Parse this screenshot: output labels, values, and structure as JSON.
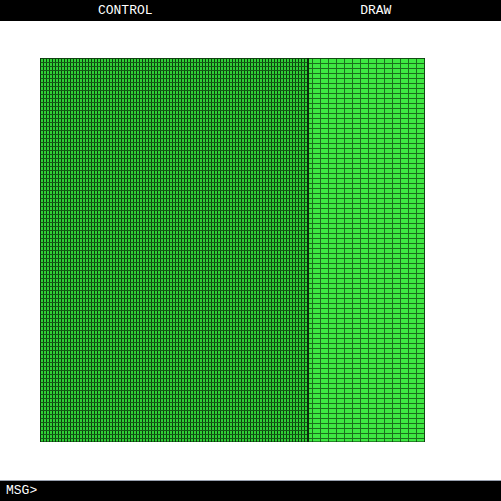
{
  "menu_bar": {
    "items": [
      {
        "label": "CONTROL"
      },
      {
        "label": "DRAW"
      }
    ]
  },
  "message_bar": {
    "prompt": "MSG>"
  }
}
